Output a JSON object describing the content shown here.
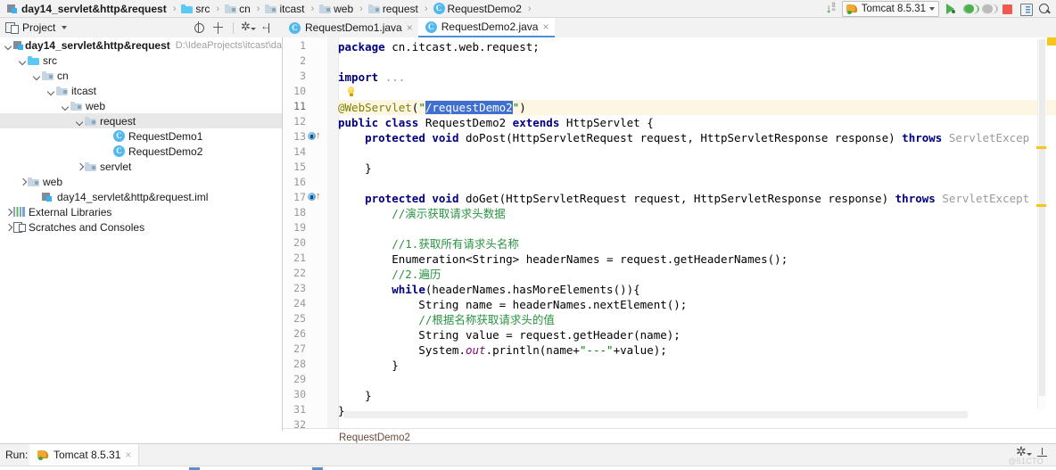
{
  "window": {
    "breadcrumb": [
      {
        "label": "day14_servlet&http&request",
        "icon": "module-icon",
        "bold": true
      },
      {
        "label": "src",
        "icon": "folder-source-icon"
      },
      {
        "label": "cn",
        "icon": "folder-icon"
      },
      {
        "label": "itcast",
        "icon": "folder-icon"
      },
      {
        "label": "web",
        "icon": "folder-icon"
      },
      {
        "label": "request",
        "icon": "folder-icon"
      },
      {
        "label": "RequestDemo2",
        "icon": "class-icon"
      }
    ],
    "separator": "›"
  },
  "toolbar": {
    "sort_icon": "sort-alphabetically-icon",
    "run_config": {
      "name": "Tomcat 8.5.31",
      "icon": "tomcat-icon",
      "caret": "chevron-down-icon"
    },
    "actions": [
      {
        "name": "run-button",
        "icon": "play-icon"
      },
      {
        "name": "debug-button",
        "icon": "bug-icon"
      },
      {
        "name": "run-with-coverage-button",
        "icon": "coverage-icon"
      },
      {
        "name": "stop-button",
        "icon": "stop-icon"
      },
      {
        "name": "layout-button",
        "icon": "layout-icon"
      },
      {
        "name": "search-everywhere-button",
        "icon": "search-icon"
      }
    ]
  },
  "project_panel": {
    "title": "Project",
    "caret": "chevron-down-icon",
    "tools": [
      {
        "name": "scroll-from-source-button",
        "icon": "target-icon"
      },
      {
        "name": "collapse-all-button",
        "icon": "collapse-icon"
      },
      {
        "name": "settings-button",
        "icon": "gear-icon"
      },
      {
        "name": "hide-button",
        "icon": "hide-icon"
      }
    ],
    "tree": [
      {
        "label": "day14_servlet&http&request",
        "path": "D:\\IdeaProjects\\itcast\\da",
        "indent": 0,
        "arrow": "down",
        "icon": "module-icon",
        "bold": true,
        "selected": false
      },
      {
        "label": "src",
        "indent": 1,
        "arrow": "down",
        "icon": "folder-source-icon",
        "selected": false
      },
      {
        "label": "cn",
        "indent": 2,
        "arrow": "down",
        "icon": "folder-icon",
        "selected": false
      },
      {
        "label": "itcast",
        "indent": 3,
        "arrow": "down",
        "icon": "folder-icon",
        "selected": false
      },
      {
        "label": "web",
        "indent": 4,
        "arrow": "down",
        "icon": "folder-icon",
        "selected": false
      },
      {
        "label": "request",
        "indent": 5,
        "arrow": "down",
        "icon": "folder-icon",
        "selected": true
      },
      {
        "label": "RequestDemo1",
        "indent": 7,
        "arrow": "none",
        "icon": "class-icon",
        "selected": false
      },
      {
        "label": "RequestDemo2",
        "indent": 7,
        "arrow": "none",
        "icon": "class-icon",
        "selected": false
      },
      {
        "label": "servlet",
        "indent": 5,
        "arrow": "right",
        "icon": "folder-icon",
        "selected": false
      },
      {
        "label": "web",
        "indent": 1,
        "arrow": "right",
        "icon": "folder-icon",
        "selected": false
      },
      {
        "label": "day14_servlet&http&request.iml",
        "indent": 2,
        "arrow": "none",
        "icon": "module-icon",
        "selected": false
      },
      {
        "label": "External Libraries",
        "indent": 0,
        "arrow": "right",
        "icon": "library-icon",
        "selected": false
      },
      {
        "label": "Scratches and Consoles",
        "indent": 0,
        "arrow": "right",
        "icon": "scratches-icon",
        "selected": false
      }
    ]
  },
  "editor_tabs": [
    {
      "label": "RequestDemo1.java",
      "icon": "class-icon",
      "active": false,
      "close": "×"
    },
    {
      "label": "RequestDemo2.java",
      "icon": "class-icon",
      "active": true,
      "close": "×"
    }
  ],
  "editor": {
    "line_numbers": [
      "1",
      "2",
      "3",
      "10",
      "11",
      "12",
      "13",
      "14",
      "15",
      "16",
      "17",
      "18",
      "19",
      "20",
      "21",
      "22",
      "23",
      "24",
      "25",
      "26",
      "27",
      "28",
      "29",
      "30",
      "31",
      "32"
    ],
    "highlighted_line_number": "11",
    "selection_text": "/requestDemo2",
    "lines": [
      "package cn.itcast.web.request;",
      "",
      "import ...",
      "",
      "@WebServlet(\"/requestDemo2\")",
      "public class RequestDemo2 extends HttpServlet {",
      "    protected void doPost(HttpServletRequest request, HttpServletResponse response) throws ServletExcep",
      "",
      "    }",
      "",
      "    protected void doGet(HttpServletRequest request, HttpServletResponse response) throws ServletExcept",
      "        //演示获取请求头数据",
      "",
      "        //1.获取所有请求头名称",
      "        Enumeration<String> headerNames = request.getHeaderNames();",
      "        //2.遍历",
      "        while(headerNames.hasMoreElements()){",
      "            String name = headerNames.nextElement();",
      "            //根据名称获取请求头的值",
      "            String value = request.getHeader(name);",
      "            System.out.println(name+\"---\"+value);",
      "        }",
      "",
      "    }",
      "}",
      ""
    ],
    "gutter_markers": [
      {
        "line": "13",
        "icon": "override-method-icon"
      },
      {
        "line": "17",
        "icon": "override-method-icon"
      }
    ],
    "intention_bulb": "lightbulb-icon",
    "bottom_breadcrumb": "RequestDemo2"
  },
  "run_window": {
    "label": "Run:",
    "tab": {
      "label": "Tomcat 8.5.31",
      "icon": "tomcat-icon",
      "close": "×"
    },
    "tools": [
      {
        "name": "run-settings-button",
        "icon": "gear-icon"
      },
      {
        "name": "hide-run-window-button",
        "icon": "hide-icon"
      }
    ],
    "watermark": "@51CTO"
  },
  "colors": {
    "accent": "#4a90d9",
    "keyword": "#000080",
    "string": "#008000",
    "comment": "#2a9242",
    "annotation": "#808000",
    "selection": "#3f6fd1",
    "tomcat": "#f0a830",
    "run_green": "#4caf50",
    "stop_red": "#f05a50",
    "warning_marker": "#f5c518"
  }
}
